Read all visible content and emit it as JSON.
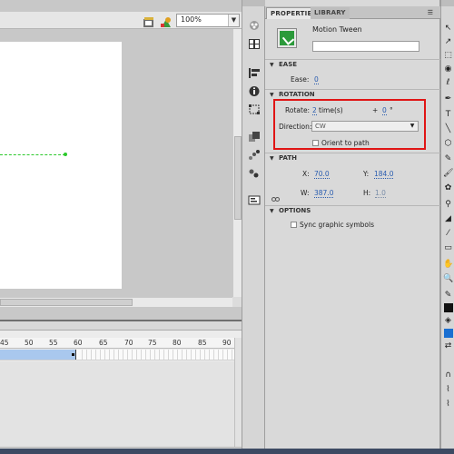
{
  "stage": {
    "zoom": "100%"
  },
  "timeline": {
    "ruler_labels": [
      "45",
      "50",
      "55",
      "60",
      "65",
      "70",
      "75",
      "80",
      "85",
      "90"
    ]
  },
  "properties": {
    "tabs": [
      "PROPERTIES",
      "LIBRARY"
    ],
    "instance_type": "Motion Tween",
    "instance_name_placeholder": "",
    "ease": {
      "section": "EASE",
      "label": "Ease:",
      "value": "0"
    },
    "rotation": {
      "section": "ROTATION",
      "rotate_label": "Rotate:",
      "rotate_times": "2",
      "times_suffix": "time(s)",
      "plus": "+",
      "rotate_degrees": "0",
      "degree_symbol": "°",
      "direction_label": "Direction:",
      "direction_value": "CW",
      "orient_label": "Orient to path"
    },
    "path": {
      "section": "PATH",
      "x_label": "X:",
      "x_value": "70.0",
      "y_label": "Y:",
      "y_value": "184.0",
      "w_label": "W:",
      "w_value": "387.0",
      "h_label": "H:",
      "h_value": "1.0"
    },
    "options": {
      "section": "OPTIONS",
      "sync_label": "Sync graphic symbols"
    }
  },
  "colors": {
    "highlight": "#e01515",
    "tween_frames": "#a9c8ee",
    "motion_path": "#2cc92c",
    "value_link": "#2a5db0"
  }
}
